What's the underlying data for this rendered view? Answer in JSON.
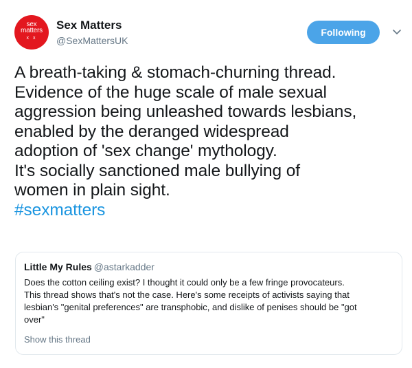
{
  "account": {
    "name": "Sex Matters",
    "handle": "@SexMattersUK",
    "avatar_text": [
      "sex",
      "matters",
      "x  x"
    ],
    "avatar_color": "#e3171f"
  },
  "follow_button": {
    "label": "Following",
    "color": "#4ba4e8"
  },
  "menu": {
    "icon": "chevron-down-icon"
  },
  "tweet": {
    "lines": [
      "A breath-taking & stomach-churning thread.",
      "Evidence of the huge scale of male sexual",
      "aggression being unleashed towards lesbians,",
      "enabled by the deranged widespread",
      "adoption of 'sex change' mythology.",
      "It's socially sanctioned male bullying of",
      "women in plain sight."
    ],
    "hashtag": "#sexmatters",
    "hashtag_color": "#1b95e0"
  },
  "quoted_tweet": {
    "name": "Little My Rules",
    "handle": "@astarkadder",
    "lines": [
      "Does the cotton ceiling exist?  I thought it could only be a few fringe provocateurs.",
      "This thread shows that's not the case.  Here's some receipts of activists saying that",
      "lesbian's \"genital preferences\" are transphobic, and dislike of penises should be \"got",
      "over\""
    ],
    "show_thread": "Show this thread"
  }
}
